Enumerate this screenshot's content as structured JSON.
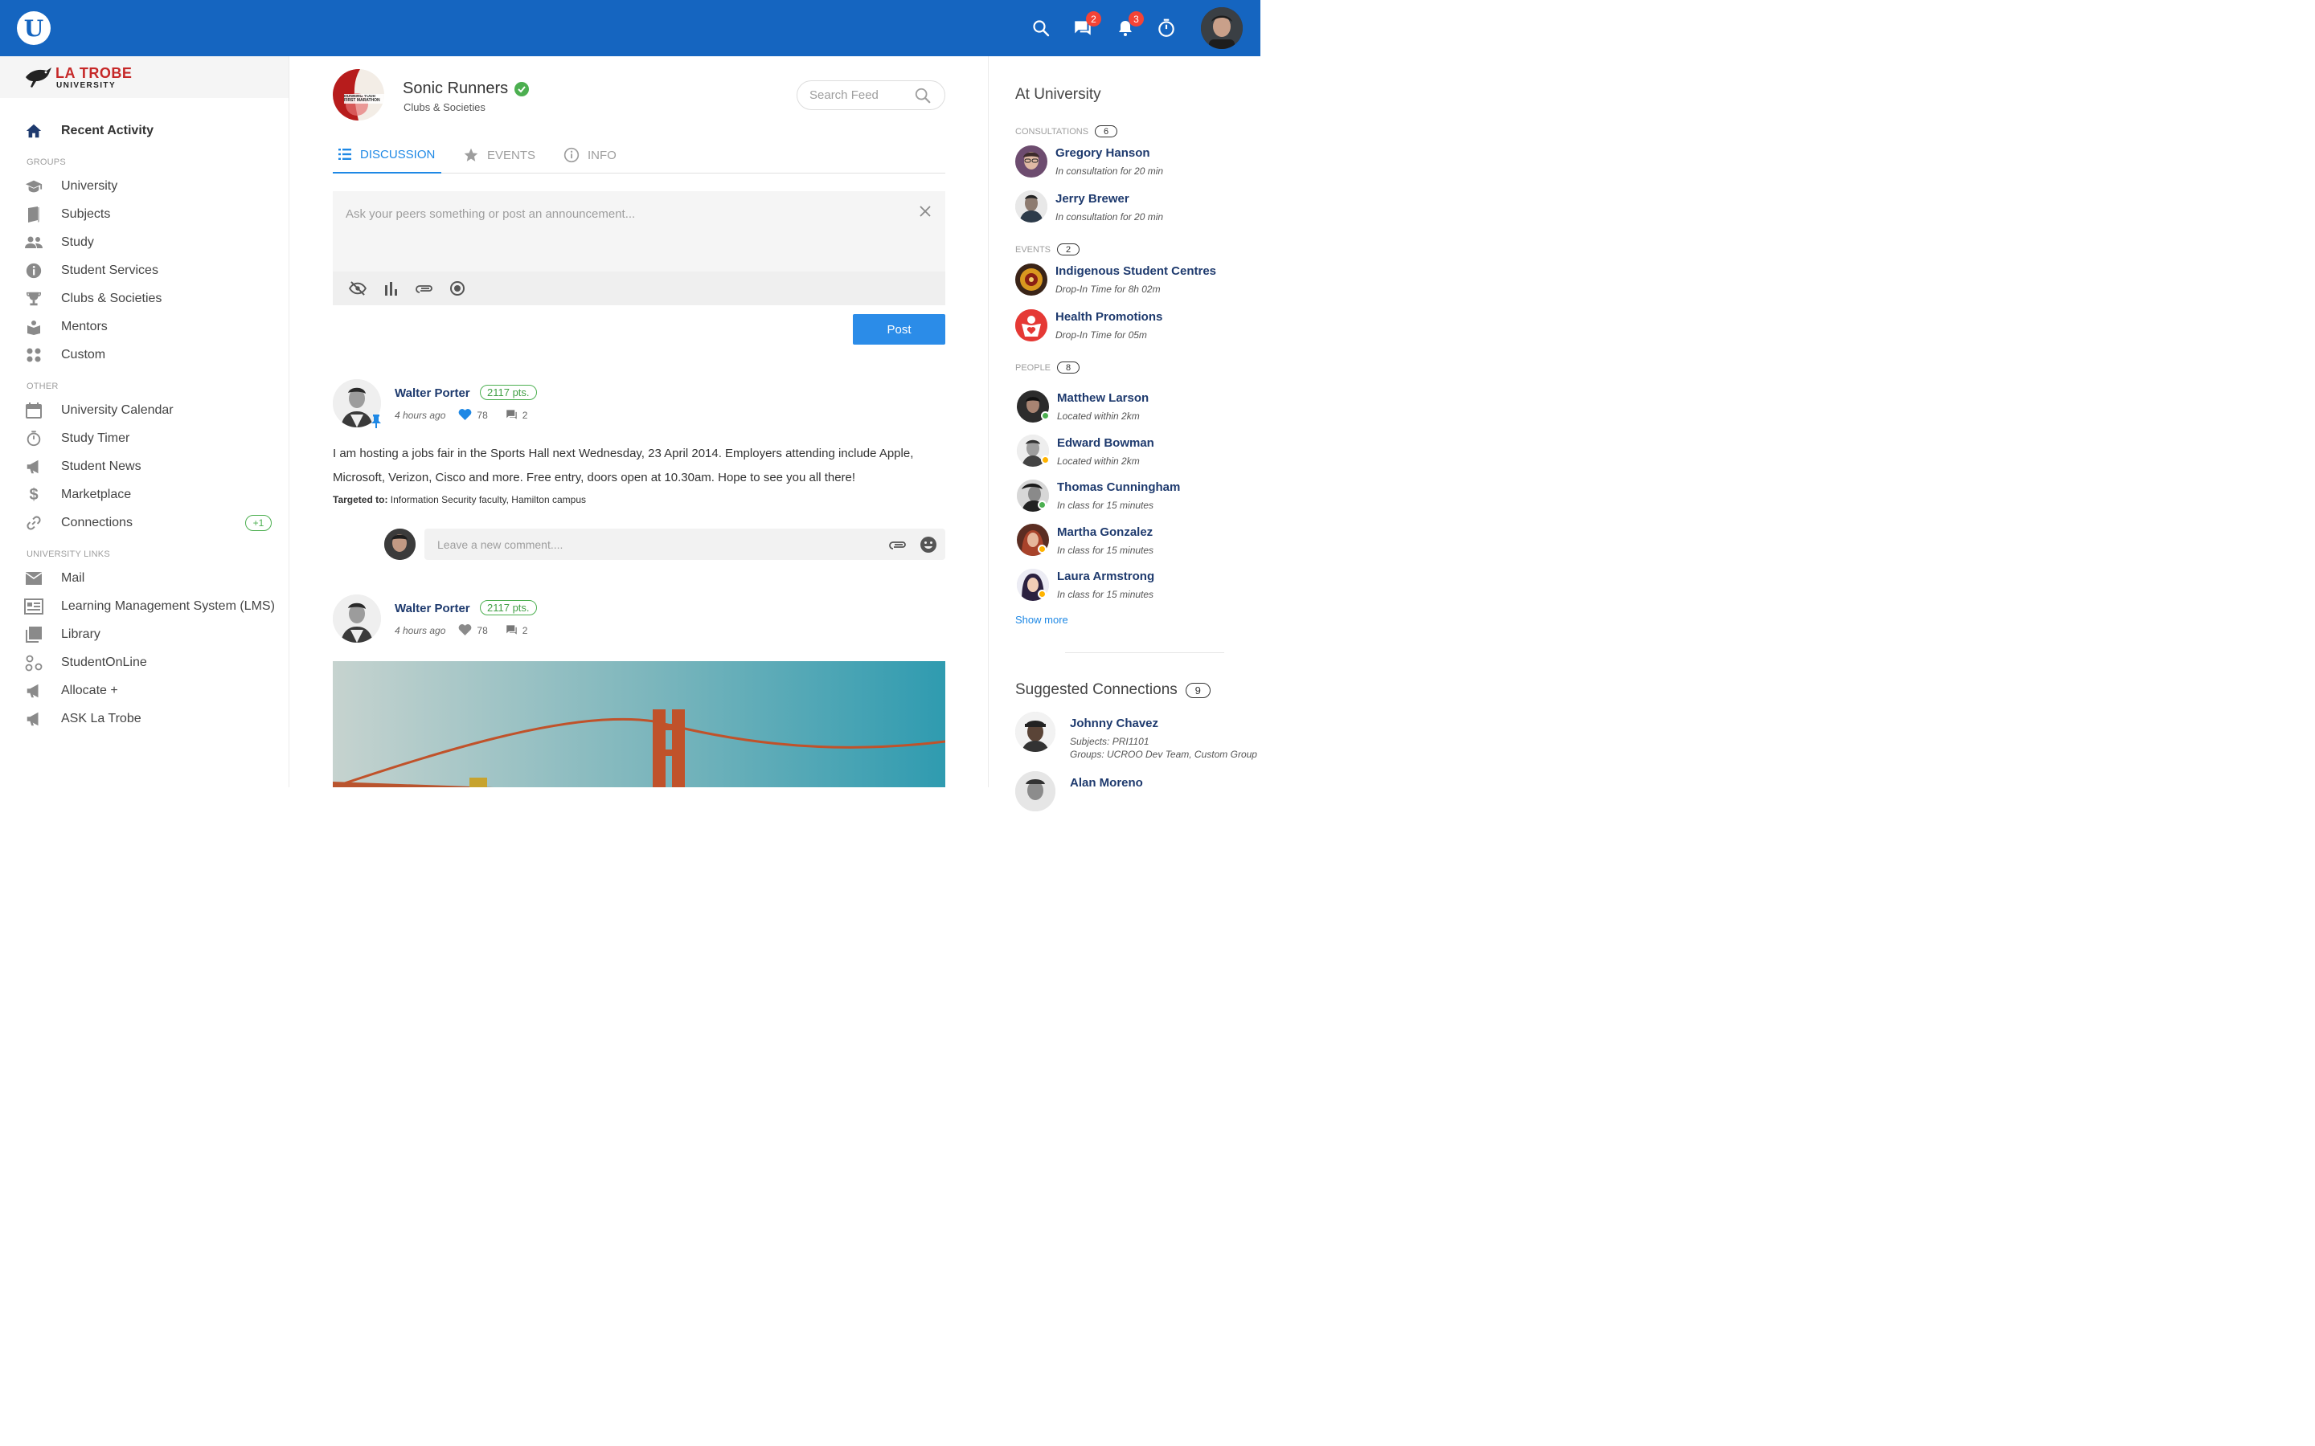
{
  "topbar": {
    "logo_letter": "U",
    "icons": [
      "search-icon",
      "chat-icon",
      "bell-icon",
      "timer-icon"
    ],
    "chat_badge": "2",
    "bell_badge": "3",
    "accent": "#1565c0"
  },
  "brand": {
    "name": "LA TROBE",
    "sub": "UNIVERSITY"
  },
  "sidebar": {
    "recent": "Recent Activity",
    "groups_header": "GROUPS",
    "groups": [
      {
        "label": "University",
        "icon": "graduation-cap-icon"
      },
      {
        "label": "Subjects",
        "icon": "book-icon"
      },
      {
        "label": "Study",
        "icon": "people-icon"
      },
      {
        "label": "Student Services",
        "icon": "info-icon"
      },
      {
        "label": "Clubs & Societies",
        "icon": "trophy-icon"
      },
      {
        "label": "Mentors",
        "icon": "mentor-icon"
      },
      {
        "label": "Custom",
        "icon": "grid-dots-icon"
      }
    ],
    "other_header": "OTHER",
    "other": [
      {
        "label": "University Calendar",
        "icon": "calendar-icon"
      },
      {
        "label": "Study Timer",
        "icon": "stopwatch-icon"
      },
      {
        "label": "Student News",
        "icon": "megaphone-icon"
      },
      {
        "label": "Marketplace",
        "icon": "dollar-icon"
      },
      {
        "label": "Connections",
        "icon": "link-icon",
        "badge": "+1"
      }
    ],
    "links_header": "UNIVERSITY LINKS",
    "links": [
      {
        "label": "Mail",
        "icon": "mail-icon"
      },
      {
        "label": "Learning Management System (LMS)",
        "icon": "lms-icon"
      },
      {
        "label": "Library",
        "icon": "library-icon"
      },
      {
        "label": "StudentOnLine",
        "icon": "network-icon"
      },
      {
        "label": "Allocate +",
        "icon": "megaphone-icon"
      },
      {
        "label": "ASK La Trobe",
        "icon": "megaphone-icon"
      }
    ]
  },
  "group": {
    "name": "Sonic Runners",
    "category": "Clubs & Societies",
    "avatar_text": "RUNNING YOUR FIRST MARATHON"
  },
  "search": {
    "placeholder": "Search Feed"
  },
  "tabs": [
    {
      "label": "DISCUSSION",
      "active": true
    },
    {
      "label": "EVENTS",
      "active": false
    },
    {
      "label": "INFO",
      "active": false
    }
  ],
  "composer": {
    "placeholder": "Ask your peers something or post an announcement...",
    "post_label": "Post"
  },
  "posts": [
    {
      "author": "Walter Porter",
      "points": "2117 pts.",
      "time": "4 hours ago",
      "likes": "78",
      "comments": "2",
      "body": "I am hosting a jobs fair in the Sports Hall next Wednesday, 23 April 2014. Employers attending include Apple, Microsoft, Verizon, Cisco and more. Free entry, doors open at 10.30am. Hope to see you all there!",
      "targeted_label": "Targeted to:",
      "targeted_value": "Information Security faculty, Hamilton campus",
      "comment_placeholder": "Leave a new comment...."
    },
    {
      "author": "Walter Porter",
      "points": "2117 pts.",
      "time": "4 hours ago",
      "likes": "78",
      "comments": "2"
    }
  ],
  "right": {
    "title": "At University",
    "consultations_header": "CONSULTATIONS",
    "consultations_count": "6",
    "consultations": [
      {
        "name": "Gregory Hanson",
        "sub": "In consultation for 20 min"
      },
      {
        "name": "Jerry Brewer",
        "sub": "In consultation for 20 min"
      }
    ],
    "events_header": "EVENTS",
    "events_count": "2",
    "events": [
      {
        "name": "Indigenous Student Centres",
        "sub": "Drop-In Time for 8h 02m"
      },
      {
        "name": "Health Promotions",
        "sub": "Drop-In Time for 05m"
      }
    ],
    "people_header": "PEOPLE",
    "people_count": "8",
    "people": [
      {
        "name": "Matthew Larson",
        "sub": "Located within 2km",
        "status": "#4caf50"
      },
      {
        "name": "Edward Bowman",
        "sub": "Located within 2km",
        "status": "#ffb300"
      },
      {
        "name": "Thomas Cunningham",
        "sub": "In class for 15 minutes",
        "status": "#4caf50"
      },
      {
        "name": "Martha Gonzalez",
        "sub": "In class for 15 minutes",
        "status": "#ffb300"
      },
      {
        "name": "Laura Armstrong",
        "sub": "In class for 15 minutes",
        "status": "#ffb300"
      }
    ],
    "show_more": "Show more",
    "suggested_title": "Suggested Connections",
    "suggested_count": "9",
    "suggested": [
      {
        "name": "Johnny Chavez",
        "sub1": "Subjects: PRI1101",
        "sub2": "Groups: UCROO Dev Team, Custom Group"
      },
      {
        "name": "Alan Moreno"
      }
    ]
  }
}
